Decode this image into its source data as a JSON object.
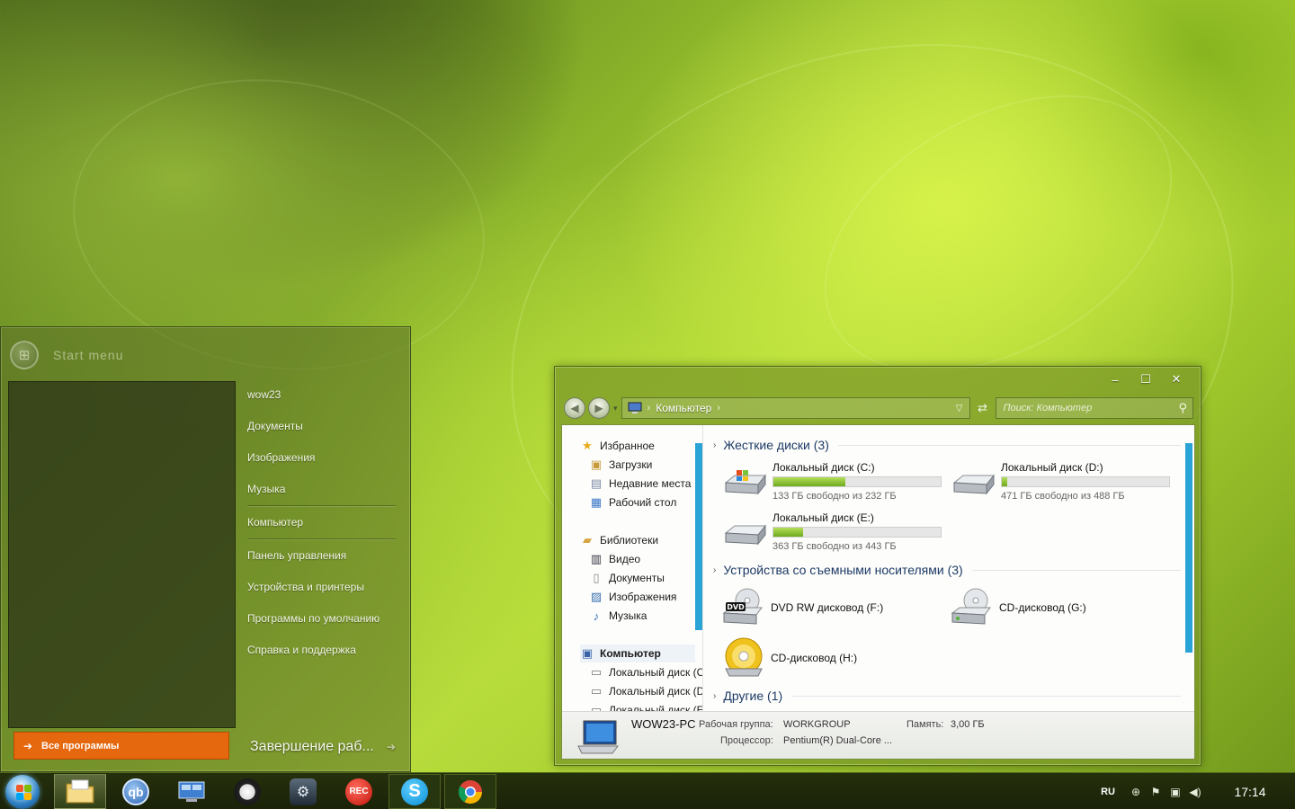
{
  "start_menu": {
    "title": "Start menu",
    "user_items": [
      "wow23",
      "Документы",
      "Изображения",
      "Музыка"
    ],
    "system_items": [
      "Компьютер",
      "Панель управления",
      "Устройства и принтеры",
      "Программы по умолчанию",
      "Справка и поддержка"
    ],
    "all_programs": "Все программы",
    "shutdown": "Завершение раб..."
  },
  "explorer": {
    "breadcrumb": [
      "Компьютер"
    ],
    "search_placeholder": "Поиск: Компьютер",
    "nav": {
      "favorites": "Избранное",
      "favorites_items": [
        "Загрузки",
        "Недавние места",
        "Рабочий стол"
      ],
      "libraries": "Библиотеки",
      "libraries_items": [
        "Видео",
        "Документы",
        "Изображения",
        "Музыка"
      ],
      "computer": "Компьютер",
      "computer_items": [
        "Локальный диск (C:)",
        "Локальный диск (D:)",
        "Локальный диск (E:)"
      ]
    },
    "groups": {
      "hard_drives": "Жесткие диски (3)",
      "removable": "Устройства со съемными носителями (3)",
      "other": "Другие (1)"
    },
    "drives": [
      {
        "name": "Локальный диск (C:)",
        "free": "133 ГБ свободно из 232 ГБ",
        "used_fraction": 0.43
      },
      {
        "name": "Локальный диск (D:)",
        "free": "471 ГБ свободно из 488 ГБ",
        "used_fraction": 0.03
      },
      {
        "name": "Локальный диск (E:)",
        "free": "363 ГБ свободно из 443 ГБ",
        "used_fraction": 0.18
      }
    ],
    "removable": [
      {
        "name": "DVD RW дисковод (F:)",
        "icon": "dvd-drive-icon",
        "badge": "DVD"
      },
      {
        "name": "CD-дисковод (G:)",
        "icon": "cd-drive-icon"
      },
      {
        "name": "CD-дисковод (H:)",
        "icon": "cd-disc-icon"
      }
    ],
    "details": {
      "pc_name": "WOW23-PC",
      "workgroup_label": "Рабочая группа:",
      "workgroup": "WORKGROUP",
      "memory_label": "Память:",
      "memory": "3,00 ГБ",
      "cpu_label": "Процессор:",
      "cpu": "Pentium(R) Dual-Core ..."
    }
  },
  "taskbar": {
    "buttons": [
      {
        "name": "explorer",
        "icon": "folder-icon"
      },
      {
        "name": "qbittorrent",
        "icon": "qbittorrent-icon",
        "text": "qb"
      },
      {
        "name": "control-panel",
        "icon": "network-icon"
      },
      {
        "name": "tool",
        "icon": "media-icon"
      },
      {
        "name": "steam",
        "icon": "steam-icon"
      },
      {
        "name": "recorder",
        "icon": "rec-icon",
        "text": "REC"
      },
      {
        "name": "skype",
        "icon": "skype-icon",
        "text": "S"
      },
      {
        "name": "chrome",
        "icon": "chrome-icon"
      }
    ],
    "lang": "RU",
    "clock": "17:14"
  },
  "colors": {
    "accent_orange": "#e5670e",
    "progress_green": "#6faa1c",
    "scrollbar_blue": "#2aa3d6",
    "taskbar": "#1a2208"
  }
}
